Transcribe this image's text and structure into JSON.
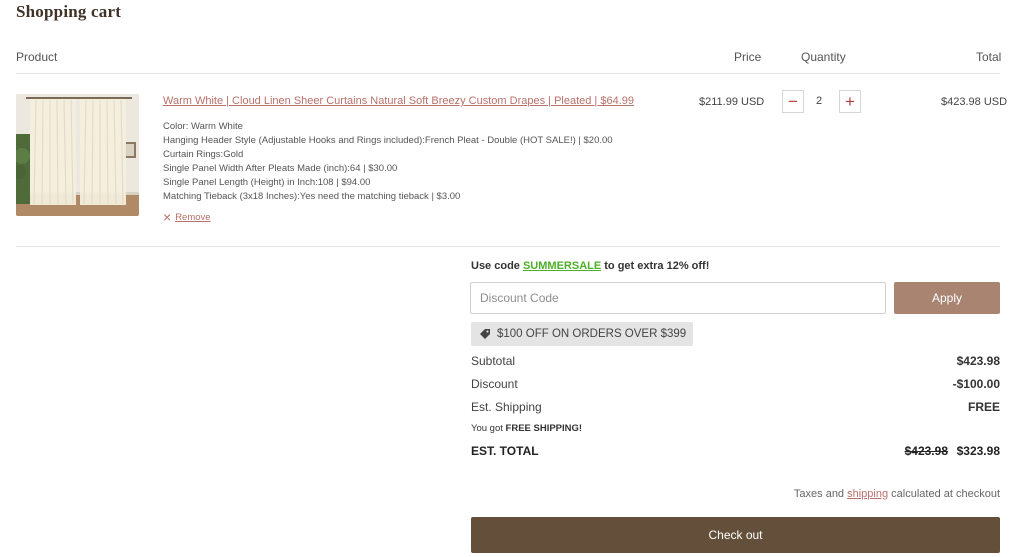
{
  "page_title": "Shopping cart",
  "columns": {
    "product": "Product",
    "price": "Price",
    "quantity": "Quantity",
    "total": "Total"
  },
  "item": {
    "title": "Warm White | Cloud Linen Sheer Curtains Natural Soft Breezy Custom Drapes | Pleated | $64.99",
    "options": [
      "Color: Warm White",
      "Hanging Header Style (Adjustable Hooks and Rings included):French Pleat - Double (HOT SALE!) | $20.00",
      "Curtain Rings:Gold",
      "Single Panel Width After Pleats Made (inch):64 | $30.00",
      "Single Panel Length (Height) in Inch:108 | $94.00",
      "Matching Tieback (3x18 Inches):Yes need the matching tieback | $3.00"
    ],
    "remove_label": "Remove",
    "price": "$211.99 USD",
    "quantity": "2",
    "line_total": "$423.98 USD"
  },
  "promo": {
    "prefix": "Use code ",
    "code": "SUMMERSALE",
    "suffix": " to get extra 12% off!"
  },
  "discount": {
    "placeholder": "Discount Code",
    "apply_label": "Apply"
  },
  "applied_tag": {
    "text": "$100 OFF ON ORDERS OVER $399",
    "icon": "tag-icon"
  },
  "summary": {
    "subtotal_label": "Subtotal",
    "subtotal_value": "$423.98",
    "discount_label": "Discount",
    "discount_value": "-$100.00",
    "shipping_label": "Est. Shipping",
    "shipping_value": "FREE",
    "free_note_prefix": "You got ",
    "free_note_bold": "FREE SHIPPING!",
    "total_label": "EST. TOTAL",
    "total_original": "$423.98",
    "total_value": "$323.98"
  },
  "taxes_note": {
    "prefix": "Taxes and ",
    "link": "shipping",
    "suffix": " calculated at checkout"
  },
  "checkout_label": "Check out",
  "colors": {
    "brand_dark": "#64503a",
    "apply": "#a88471",
    "link": "#b8706a",
    "promo_code": "#4caf2a"
  }
}
